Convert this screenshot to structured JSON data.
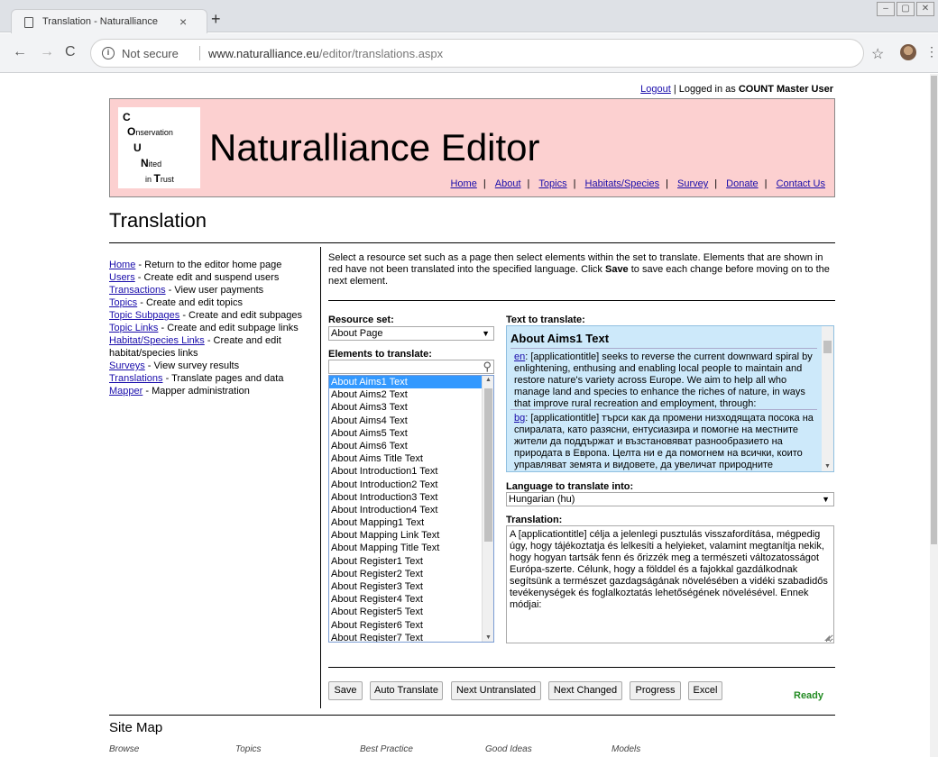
{
  "browser": {
    "tab_title": "Translation - Naturalliance",
    "tab_close": "×",
    "new_tab": "+",
    "not_secure": "Not secure",
    "url_host": "www.naturalliance.eu",
    "url_path": "/editor/translations.aspx"
  },
  "header": {
    "logout": "Logout",
    "logged_in_text": " | Logged in as ",
    "user": "COUNT Master User",
    "logo_lines": [
      {
        "cap": "C",
        "rest": ""
      },
      {
        "cap": "O",
        "rest": "nservation"
      },
      {
        "cap": "U",
        "rest": ""
      },
      {
        "cap": "N",
        "rest": "ited"
      },
      {
        "cap": "T",
        "rest": "rust",
        "prefix": "in "
      }
    ],
    "site_title": "Naturalliance Editor",
    "nav": [
      "Home",
      "About",
      "Topics",
      "Habitats/Species",
      "Survey",
      "Donate",
      "Contact Us"
    ]
  },
  "page_title": "Translation",
  "sidebar": [
    {
      "link": "Home",
      "desc": " - Return to the editor home page"
    },
    {
      "link": "Users",
      "desc": " - Create edit and suspend users"
    },
    {
      "link": "Transactions",
      "desc": " - View user payments"
    },
    {
      "link": "Topics",
      "desc": " - Create and edit topics"
    },
    {
      "link": "Topic Subpages",
      "desc": " - Create and edit subpages"
    },
    {
      "link": "Topic Links",
      "desc": " - Create and edit subpage links"
    },
    {
      "link": "Habitat/Species Links",
      "desc": " - Create and edit habitat/species links"
    },
    {
      "link": "Surveys",
      "desc": " - View survey results"
    },
    {
      "link": "Translations",
      "desc": " - Translate pages and data"
    },
    {
      "link": "Mapper",
      "desc": " - Mapper administration"
    }
  ],
  "intro": {
    "part1": "Select a resource set such as a page then select elements within the set to translate. Elements that are shown in red have not been translated into the specified language. Click ",
    "bold": "Save",
    "part2": " to save each change before moving on to the next element."
  },
  "resource_set": {
    "label": "Resource set:",
    "value": "About Page"
  },
  "elements": {
    "label": "Elements to translate:",
    "search_value": "",
    "items": [
      "About Aims1 Text",
      "About Aims2 Text",
      "About Aims3 Text",
      "About Aims4 Text",
      "About Aims5 Text",
      "About Aims6 Text",
      "About Aims Title Text",
      "About Introduction1 Text",
      "About Introduction2 Text",
      "About Introduction3 Text",
      "About Introduction4 Text",
      "About Mapping1 Text",
      "About Mapping Link Text",
      "About Mapping Title Text",
      "About Register1 Text",
      "About Register2 Text",
      "About Register3 Text",
      "About Register4 Text",
      "About Register5 Text",
      "About Register6 Text",
      "About Register7 Text"
    ],
    "selected_index": 0
  },
  "text_to_translate": {
    "label": "Text to translate:",
    "heading": "About Aims1 Text",
    "en_code": "en",
    "en_text": ": [applicationtitle] seeks to reverse the current downward spiral by enlightening, enthusing and enabling local people to maintain and restore nature's variety across Europe. We aim to help all who manage land and species to enhance the riches of nature, in ways that improve rural recreation and employment, through:",
    "bg_code": "bg",
    "bg_text": ": [applicationtitle] търси как да промени низходящата посока на спиралата, като разясни, ентусиазира и помогне на местните жители да поддържат и възстановяват разнообразието на природата в Европа. Целта ни е да помогнем на всички, които управляват земята и видовете, да увеличат природните богатства"
  },
  "language": {
    "label": "Language to translate into:",
    "value": "Hungarian (hu)"
  },
  "translation": {
    "label": "Translation:",
    "value": "A [applicationtitle] célja a jelenlegi pusztulás visszafordítása, mégpedig úgy, hogy tájékoztatja és lelkesíti a helyieket, valamint megtanítja nekik, hogy hogyan tartsák fenn és őrizzék meg a természeti változatosságot Európa-szerte. Célunk, hogy a földdel és a fajokkal gazdálkodnak segítsünk a természet gazdagságának növelésében a vidéki szabadidős tevékenységek és foglalkoztatás lehetőségének növelésével. Ennek módjai:"
  },
  "buttons": [
    "Save",
    "Auto Translate",
    "Next Untranslated",
    "Next Changed",
    "Progress",
    "Excel"
  ],
  "status": "Ready",
  "sitemap": {
    "title": "Site Map",
    "columns": [
      "Browse",
      "Topics",
      "Best Practice",
      "Good Ideas",
      "Models"
    ]
  },
  "colors": {
    "banner": "#fcd0d0",
    "text_box": "#cde9fa",
    "selected": "#3399ff",
    "ready": "#228b22",
    "link": "#1a0dab"
  }
}
